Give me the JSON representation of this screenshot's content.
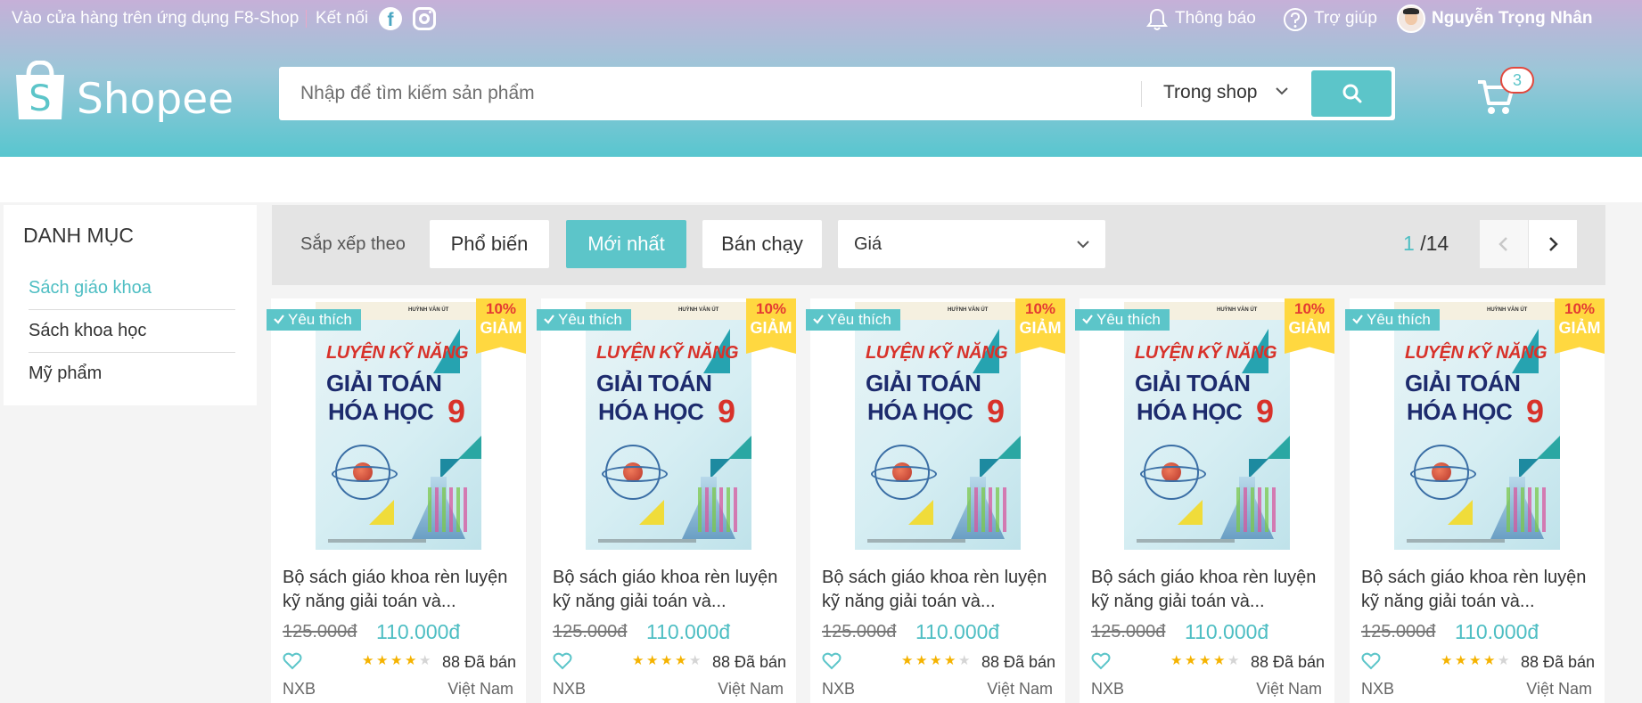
{
  "topbar": {
    "app_text": "Vào cửa hàng trên ứng dụng F8-Shop",
    "connect_text": "Kết nối",
    "notifications_label": "Thông báo",
    "help_label": "Trợ giúp",
    "user_name": "Nguyễn Trọng Nhân"
  },
  "brand": {
    "logo_text": "Shopee"
  },
  "search": {
    "placeholder": "Nhập để tìm kiếm sản phẩm",
    "scope_label": "Trong shop"
  },
  "cart": {
    "count": "3"
  },
  "sidebar": {
    "heading": "DANH MỤC",
    "items": [
      {
        "label": "Sách giáo khoa",
        "active": true
      },
      {
        "label": "Sách khoa học",
        "active": false
      },
      {
        "label": "Mỹ phẩm",
        "active": false
      }
    ]
  },
  "filter": {
    "sort_label": "Sắp xếp theo",
    "options": [
      "Phổ biến",
      "Mới nhất",
      "Bán chạy"
    ],
    "active_option": "Mới nhất",
    "price_label": "Giá",
    "page_current": "1",
    "page_total": "/14"
  },
  "products": [
    {
      "name": "Bộ sách giáo khoa rèn luyện kỹ năng giải toán và...",
      "old_price": "125.000đ",
      "new_price": "110.000đ",
      "rating": 4,
      "sold": "88 Đã bán",
      "brand": "NXB",
      "origin": "Việt Nam",
      "fav_badge": "Yêu thích",
      "sale_pct": "10%",
      "sale_label": "GIẢM"
    },
    {
      "name": "Bộ sách giáo khoa rèn luyện kỹ năng giải toán và...",
      "old_price": "125.000đ",
      "new_price": "110.000đ",
      "rating": 4,
      "sold": "88 Đã bán",
      "brand": "NXB",
      "origin": "Việt Nam",
      "fav_badge": "Yêu thích",
      "sale_pct": "10%",
      "sale_label": "GIẢM"
    },
    {
      "name": "Bộ sách giáo khoa rèn luyện kỹ năng giải toán và...",
      "old_price": "125.000đ",
      "new_price": "110.000đ",
      "rating": 4,
      "sold": "88 Đã bán",
      "brand": "NXB",
      "origin": "Việt Nam",
      "fav_badge": "Yêu thích",
      "sale_pct": "10%",
      "sale_label": "GIẢM"
    },
    {
      "name": "Bộ sách giáo khoa rèn luyện kỹ năng giải toán và...",
      "old_price": "125.000đ",
      "new_price": "110.000đ",
      "rating": 4,
      "sold": "88 Đã bán",
      "brand": "NXB",
      "origin": "Việt Nam",
      "fav_badge": "Yêu thích",
      "sale_pct": "10%",
      "sale_label": "GIẢM"
    },
    {
      "name": "Bộ sách giáo khoa rèn luyện kỹ năng giải toán và...",
      "old_price": "125.000đ",
      "new_price": "110.000đ",
      "rating": 4,
      "sold": "88 Đã bán",
      "brand": "NXB",
      "origin": "Việt Nam",
      "fav_badge": "Yêu thích",
      "sale_pct": "10%",
      "sale_label": "GIẢM"
    }
  ],
  "book_cover": {
    "author": "HUỲNH VĂN ÚT",
    "line1": "LUYỆN KỸ NĂNG",
    "line2": "GIẢI TOÁN",
    "line3": "HÓA HỌC",
    "grade": "9"
  },
  "colors": {
    "accent": "#5cc5c9",
    "accent_text": "#4ebec3",
    "sale_badge": "#ffd840",
    "sale_text": "#e43a32",
    "star": "#f5b301"
  }
}
